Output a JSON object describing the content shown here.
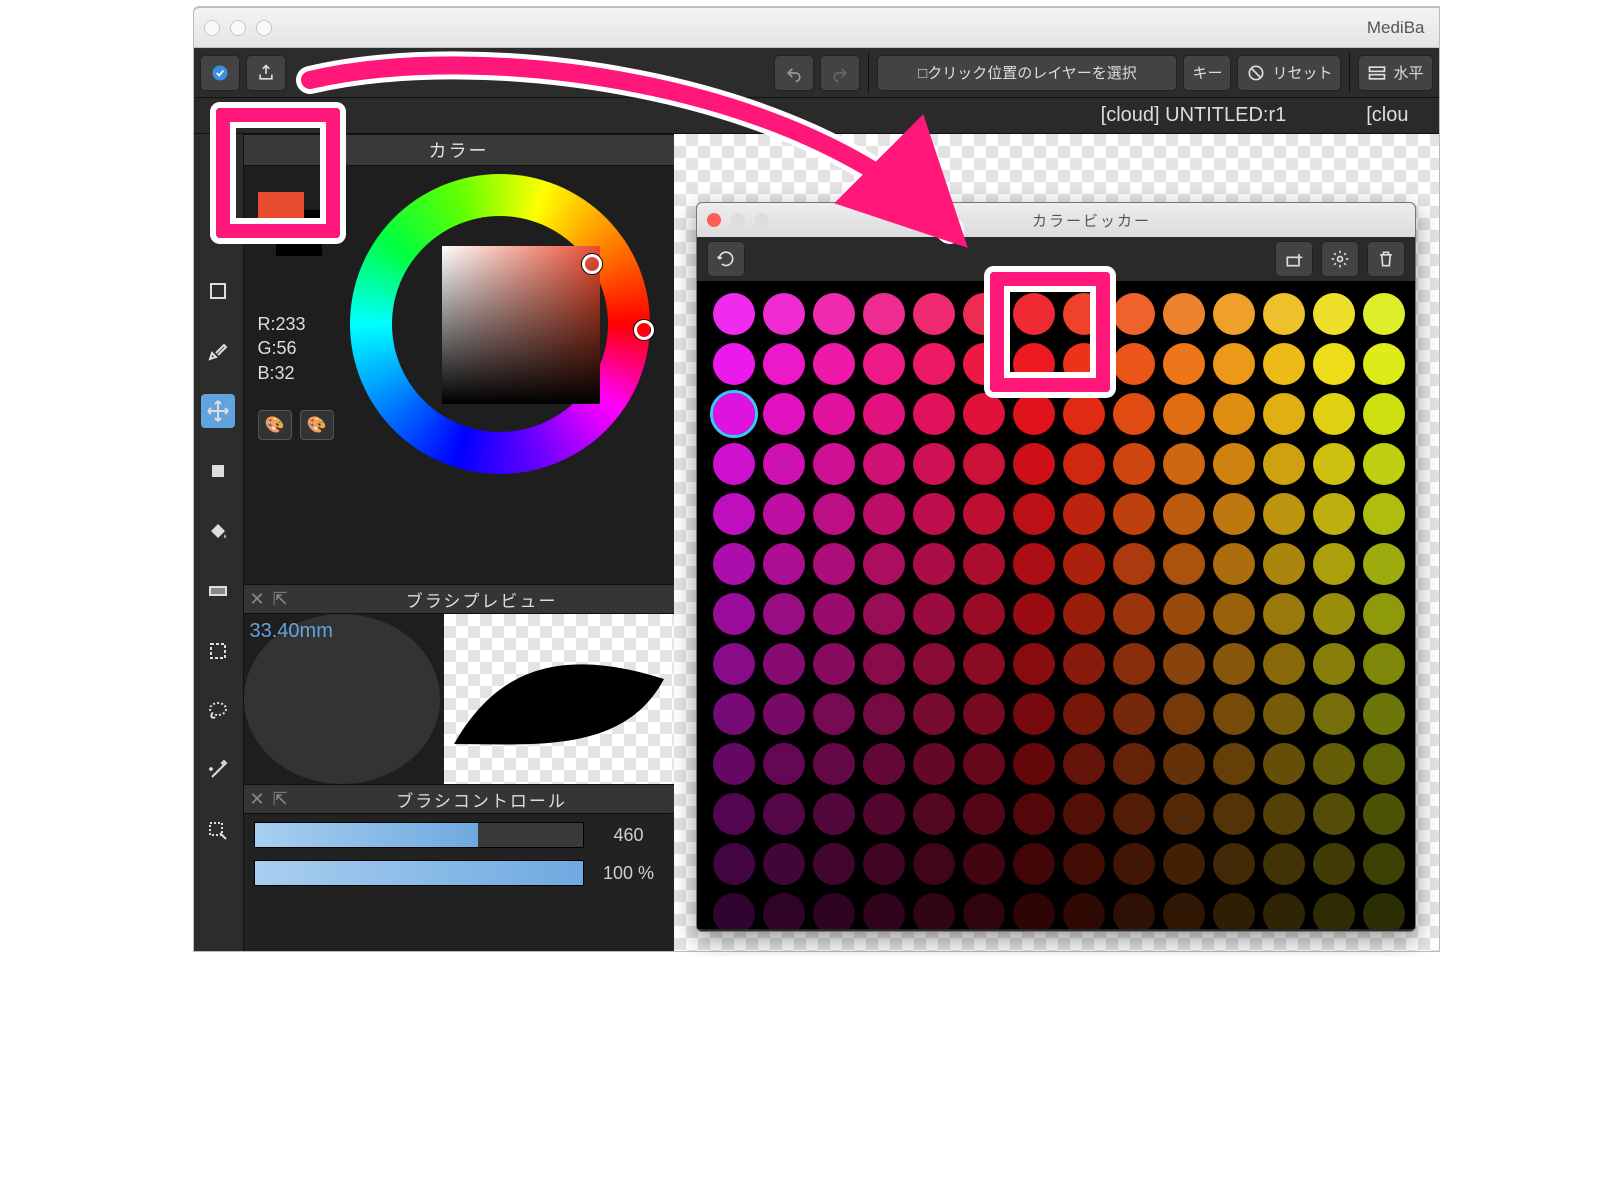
{
  "app": {
    "title": "MediBa"
  },
  "toolbar": {
    "layer_picker_label": "□クリック位置のレイヤーを選択",
    "key_label": "キー",
    "reset_label": "リセット",
    "ruler_label": "水平"
  },
  "tabs": {
    "active": "[cloud] UNTITLED:r1",
    "next": "[clou"
  },
  "color": {
    "panel_title": "カラー",
    "r": "R:233",
    "g": "G:56",
    "b": "B:32",
    "fg_hex": "#e94b2f",
    "bg_hex": "#000000"
  },
  "brush_preview": {
    "title": "ブラシプレビュー",
    "size_label": "33.40mm"
  },
  "brush_control": {
    "title": "ブラシコントロール",
    "val1": "460",
    "val2": "100 %"
  },
  "picker": {
    "title": "カラービッカー"
  }
}
